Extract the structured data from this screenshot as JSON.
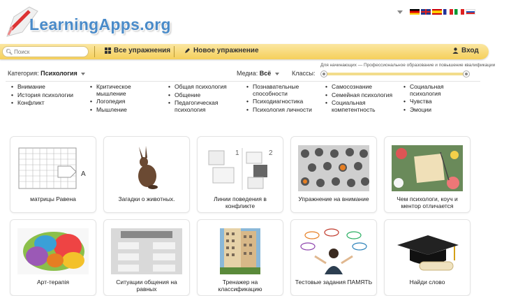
{
  "header": {
    "logo_text": "LearningApps.org",
    "search_placeholder": "Поиск",
    "all_exercises": "Все упражнения",
    "new_exercise": "Новое упражнение",
    "login": "Вход",
    "languages": [
      "de",
      "en",
      "es",
      "fr",
      "it",
      "ru"
    ]
  },
  "filters": {
    "category_label": "Категория:",
    "category_value": "Психология",
    "media_label": "Медиа:",
    "media_value": "Всё",
    "grades_label": "Классы:",
    "slider_caption": "Для начинающих — Профессиональное образование и повышение квалификации"
  },
  "categories": [
    [
      "Внимание",
      "История психологии",
      "Конфликт"
    ],
    [
      "Критическое мышление",
      "Логопедия",
      "Мышление"
    ],
    [
      "Общая психология",
      "Общение",
      "Педагогическая психология"
    ],
    [
      "Познавательные способности",
      "Психодиагностика",
      "Психология личности"
    ],
    [
      "Самосознание",
      "Семейная психология",
      "Социальная компетентность"
    ],
    [
      "Социальная психология",
      "Чувства",
      "Эмоции"
    ]
  ],
  "cards": [
    {
      "label": "матрицы Равена",
      "thumb_icon": "matrix-pattern-icon"
    },
    {
      "label": "Загадки о животных.",
      "thumb_icon": "rabbit-icon"
    },
    {
      "label": "Линии поведения в конфликте",
      "thumb_icon": "card-pairs-icon"
    },
    {
      "label": "Упражнение на внимание",
      "thumb_icon": "cats-crowd-icon"
    },
    {
      "label": "Чем психологи, коуч и ментор отличается",
      "thumb_icon": "notebook-flowers-icon"
    },
    {
      "label": "Арт-терапія",
      "thumb_icon": "colorful-brain-icon"
    },
    {
      "label": "Ситуации общения на равных",
      "thumb_icon": "list-layout-icon"
    },
    {
      "label": "Тренажер на классификацию",
      "thumb_icon": "building-icon"
    },
    {
      "label": "Тестовые задания ПАМЯТЬ",
      "thumb_icon": "thinking-girl-icon"
    },
    {
      "label": "Найди слово",
      "thumb_icon": "graduation-cap-icon"
    }
  ],
  "colors": {
    "bar": "#f5cf5b",
    "logo": "#4a8bc9"
  }
}
